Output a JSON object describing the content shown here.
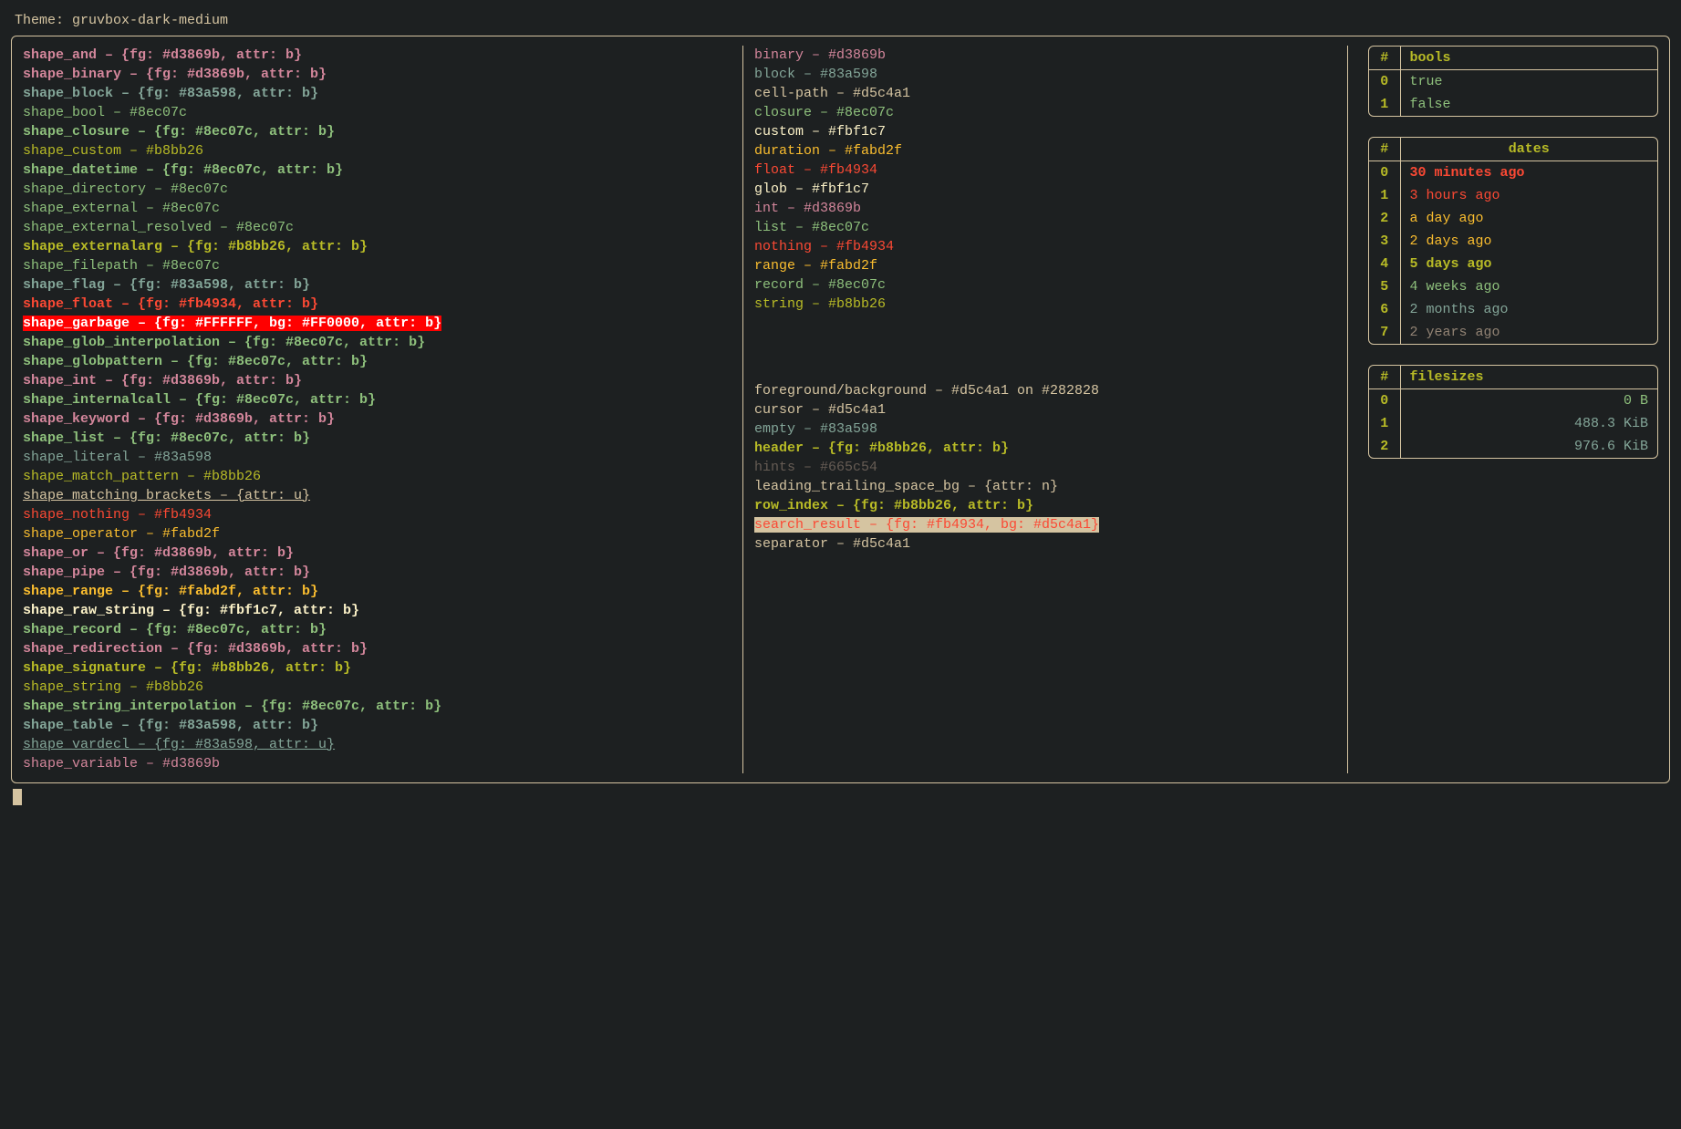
{
  "theme_label": "Theme: ",
  "theme_name": "gruvbox-dark-medium",
  "sep": " – ",
  "shapes": [
    {
      "name": "shape_and",
      "color": "#d3869b",
      "bold": true,
      "value": "{fg: #d3869b, attr: b}"
    },
    {
      "name": "shape_binary",
      "color": "#d3869b",
      "bold": true,
      "value": "{fg: #d3869b, attr: b}"
    },
    {
      "name": "shape_block",
      "color": "#83a598",
      "bold": true,
      "value": "{fg: #83a598, attr: b}"
    },
    {
      "name": "shape_bool",
      "color": "#8ec07c",
      "bold": false,
      "value": "#8ec07c"
    },
    {
      "name": "shape_closure",
      "color": "#8ec07c",
      "bold": true,
      "value": "{fg: #8ec07c, attr: b}"
    },
    {
      "name": "shape_custom",
      "color": "#b8bb26",
      "bold": false,
      "value": "#b8bb26"
    },
    {
      "name": "shape_datetime",
      "color": "#8ec07c",
      "bold": true,
      "value": "{fg: #8ec07c, attr: b}"
    },
    {
      "name": "shape_directory",
      "color": "#8ec07c",
      "bold": false,
      "value": "#8ec07c"
    },
    {
      "name": "shape_external",
      "color": "#8ec07c",
      "bold": false,
      "value": "#8ec07c"
    },
    {
      "name": "shape_external_resolved",
      "color": "#8ec07c",
      "bold": false,
      "value": "#8ec07c"
    },
    {
      "name": "shape_externalarg",
      "color": "#b8bb26",
      "bold": true,
      "value": "{fg: #b8bb26, attr: b}"
    },
    {
      "name": "shape_filepath",
      "color": "#8ec07c",
      "bold": false,
      "value": "#8ec07c"
    },
    {
      "name": "shape_flag",
      "color": "#83a598",
      "bold": true,
      "value": "{fg: #83a598, attr: b}"
    },
    {
      "name": "shape_float",
      "color": "#fb4934",
      "bold": true,
      "value": "{fg: #fb4934, attr: b}"
    },
    {
      "name": "shape_garbage",
      "color": "#FFFFFF",
      "bg": "#FF0000",
      "bold": true,
      "value": "{fg: #FFFFFF, bg: #FF0000, attr: b}"
    },
    {
      "name": "shape_glob_interpolation",
      "color": "#8ec07c",
      "bold": true,
      "value": "{fg: #8ec07c, attr: b}"
    },
    {
      "name": "shape_globpattern",
      "color": "#8ec07c",
      "bold": true,
      "value": "{fg: #8ec07c, attr: b}"
    },
    {
      "name": "shape_int",
      "color": "#d3869b",
      "bold": true,
      "value": "{fg: #d3869b, attr: b}"
    },
    {
      "name": "shape_internalcall",
      "color": "#8ec07c",
      "bold": true,
      "value": "{fg: #8ec07c, attr: b}"
    },
    {
      "name": "shape_keyword",
      "color": "#d3869b",
      "bold": true,
      "value": "{fg: #d3869b, attr: b}"
    },
    {
      "name": "shape_list",
      "color": "#8ec07c",
      "bold": true,
      "value": "{fg: #8ec07c, attr: b}"
    },
    {
      "name": "shape_literal",
      "color": "#83a598",
      "bold": false,
      "value": "#83a598"
    },
    {
      "name": "shape_match_pattern",
      "color": "#b8bb26",
      "bold": false,
      "value": "#b8bb26"
    },
    {
      "name": "shape_matching_brackets",
      "color": "#d5c4a1",
      "bold": false,
      "underline": true,
      "value": "{attr: u}"
    },
    {
      "name": "shape_nothing",
      "color": "#fb4934",
      "bold": false,
      "value": "#fb4934"
    },
    {
      "name": "shape_operator",
      "color": "#fabd2f",
      "bold": false,
      "value": "#fabd2f"
    },
    {
      "name": "shape_or",
      "color": "#d3869b",
      "bold": true,
      "value": "{fg: #d3869b, attr: b}"
    },
    {
      "name": "shape_pipe",
      "color": "#d3869b",
      "bold": true,
      "value": "{fg: #d3869b, attr: b}"
    },
    {
      "name": "shape_range",
      "color": "#fabd2f",
      "bold": true,
      "value": "{fg: #fabd2f, attr: b}"
    },
    {
      "name": "shape_raw_string",
      "color": "#fbf1c7",
      "bold": true,
      "value": "{fg: #fbf1c7, attr: b}"
    },
    {
      "name": "shape_record",
      "color": "#8ec07c",
      "bold": true,
      "value": "{fg: #8ec07c, attr: b}"
    },
    {
      "name": "shape_redirection",
      "color": "#d3869b",
      "bold": true,
      "value": "{fg: #d3869b, attr: b}"
    },
    {
      "name": "shape_signature",
      "color": "#b8bb26",
      "bold": true,
      "value": "{fg: #b8bb26, attr: b}"
    },
    {
      "name": "shape_string",
      "color": "#b8bb26",
      "bold": false,
      "value": "#b8bb26"
    },
    {
      "name": "shape_string_interpolation",
      "color": "#8ec07c",
      "bold": true,
      "value": "{fg: #8ec07c, attr: b}"
    },
    {
      "name": "shape_table",
      "color": "#83a598",
      "bold": true,
      "value": "{fg: #83a598, attr: b}"
    },
    {
      "name": "shape_vardecl",
      "color": "#83a598",
      "bold": false,
      "underline": true,
      "value": "{fg: #83a598, attr: u}"
    },
    {
      "name": "shape_variable",
      "color": "#d3869b",
      "bold": false,
      "value": "#d3869b"
    }
  ],
  "types": [
    {
      "name": "binary",
      "color": "#d3869b",
      "value": "#d3869b"
    },
    {
      "name": "block",
      "color": "#83a598",
      "value": "#83a598"
    },
    {
      "name": "cell-path",
      "color": "#d5c4a1",
      "value": "#d5c4a1"
    },
    {
      "name": "closure",
      "color": "#8ec07c",
      "value": "#8ec07c"
    },
    {
      "name": "custom",
      "color": "#fbf1c7",
      "value": "#fbf1c7"
    },
    {
      "name": "duration",
      "color": "#fabd2f",
      "value": "#fabd2f"
    },
    {
      "name": "float",
      "color": "#fb4934",
      "value": "#fb4934"
    },
    {
      "name": "glob",
      "color": "#fbf1c7",
      "value": "#fbf1c7"
    },
    {
      "name": "int",
      "color": "#d3869b",
      "value": "#d3869b"
    },
    {
      "name": "list",
      "color": "#8ec07c",
      "value": "#8ec07c"
    },
    {
      "name": "nothing",
      "color": "#fb4934",
      "value": "#fb4934"
    },
    {
      "name": "range",
      "color": "#fabd2f",
      "value": "#fabd2f"
    },
    {
      "name": "record",
      "color": "#8ec07c",
      "value": "#8ec07c"
    },
    {
      "name": "string",
      "color": "#b8bb26",
      "value": "#b8bb26"
    }
  ],
  "ui": [
    {
      "name": "foreground/background",
      "color": "#d5c4a1",
      "value": "#d5c4a1 on #282828"
    },
    {
      "name": "cursor",
      "color": "#d5c4a1",
      "value": "#d5c4a1"
    },
    {
      "name": "empty",
      "color": "#83a598",
      "value": "#83a598"
    },
    {
      "name": "header",
      "color": "#b8bb26",
      "bold": true,
      "value": "{fg: #b8bb26, attr: b}"
    },
    {
      "name": "hints",
      "color": "#665c54",
      "value": "#665c54"
    },
    {
      "name": "leading_trailing_space_bg",
      "color": "#d5c4a1",
      "value": "{attr: n}"
    },
    {
      "name": "row_index",
      "color": "#b8bb26",
      "bold": true,
      "value": "{fg: #b8bb26, attr: b}"
    },
    {
      "name": "search_result",
      "color": "#fb4934",
      "bg": "#d5c4a1",
      "value": "{fg: #fb4934, bg: #d5c4a1}"
    },
    {
      "name": "separator",
      "color": "#d5c4a1",
      "value": "#d5c4a1"
    }
  ],
  "tables": {
    "bools": {
      "header_idx": "#",
      "header_val": "bools",
      "rows": [
        {
          "idx": "0",
          "text": "true",
          "color": "#8ec07c"
        },
        {
          "idx": "1",
          "text": "false",
          "color": "#8ec07c"
        }
      ]
    },
    "dates": {
      "header_idx": "#",
      "header_val": "dates",
      "rows": [
        {
          "idx": "0",
          "text": "30 minutes ago",
          "color": "#fb4934",
          "bold": true
        },
        {
          "idx": "1",
          "text": "3 hours ago",
          "color": "#fb4934"
        },
        {
          "idx": "2",
          "text": "a day ago",
          "color": "#fabd2f"
        },
        {
          "idx": "3",
          "text": "2 days ago",
          "color": "#fabd2f"
        },
        {
          "idx": "4",
          "text": "5 days ago",
          "color": "#b8bb26",
          "bold": true
        },
        {
          "idx": "5",
          "text": "4 weeks ago",
          "color": "#8ec07c"
        },
        {
          "idx": "6",
          "text": "2 months ago",
          "color": "#83a598"
        },
        {
          "idx": "7",
          "text": "2 years ago",
          "color": "#928374"
        }
      ]
    },
    "filesizes": {
      "header_idx": "#",
      "header_val": "filesizes",
      "rows": [
        {
          "idx": "0",
          "text": "0 B",
          "color": "#8ec07c",
          "right": true
        },
        {
          "idx": "1",
          "text": "488.3 KiB",
          "color": "#83a598",
          "right": true
        },
        {
          "idx": "2",
          "text": "976.6 KiB",
          "color": "#83a598",
          "right": true
        }
      ]
    }
  }
}
